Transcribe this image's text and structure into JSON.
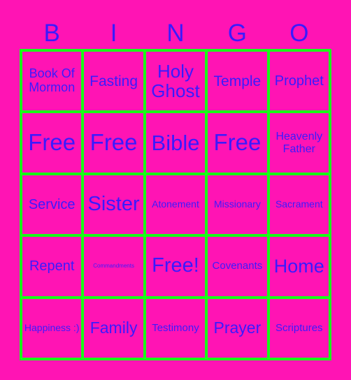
{
  "header": [
    "B",
    "I",
    "N",
    "G",
    "O"
  ],
  "colors": {
    "background": "#ff14b4",
    "grid": "#18ff18",
    "text": "#3a1aff"
  },
  "cells": [
    {
      "text": "Book Of Mormon",
      "size": 18
    },
    {
      "text": "Fasting",
      "size": 21
    },
    {
      "text": "Holy Ghost",
      "size": 26
    },
    {
      "text": "Temple",
      "size": 21
    },
    {
      "text": "Prophet",
      "size": 20
    },
    {
      "text": "Free",
      "size": 33
    },
    {
      "text": "Free",
      "size": 33
    },
    {
      "text": "Bible",
      "size": 31
    },
    {
      "text": "Free",
      "size": 33
    },
    {
      "text": "Heavenly Father",
      "size": 16
    },
    {
      "text": "Service",
      "size": 20
    },
    {
      "text": "Sister",
      "size": 29
    },
    {
      "text": "Atonement",
      "size": 14
    },
    {
      "text": "Missionary",
      "size": 14
    },
    {
      "text": "Sacrament",
      "size": 14
    },
    {
      "text": "Repent",
      "size": 20
    },
    {
      "text": "Commandments",
      "size": 8
    },
    {
      "text": "Free!",
      "size": 29
    },
    {
      "text": "Covenants",
      "size": 15
    },
    {
      "text": "Home",
      "size": 27
    },
    {
      "text": "Happiness :)",
      "size": 14
    },
    {
      "text": "Family",
      "size": 23
    },
    {
      "text": "Testimony",
      "size": 15
    },
    {
      "text": "Prayer",
      "size": 23
    },
    {
      "text": "Scriptures",
      "size": 15
    }
  ]
}
